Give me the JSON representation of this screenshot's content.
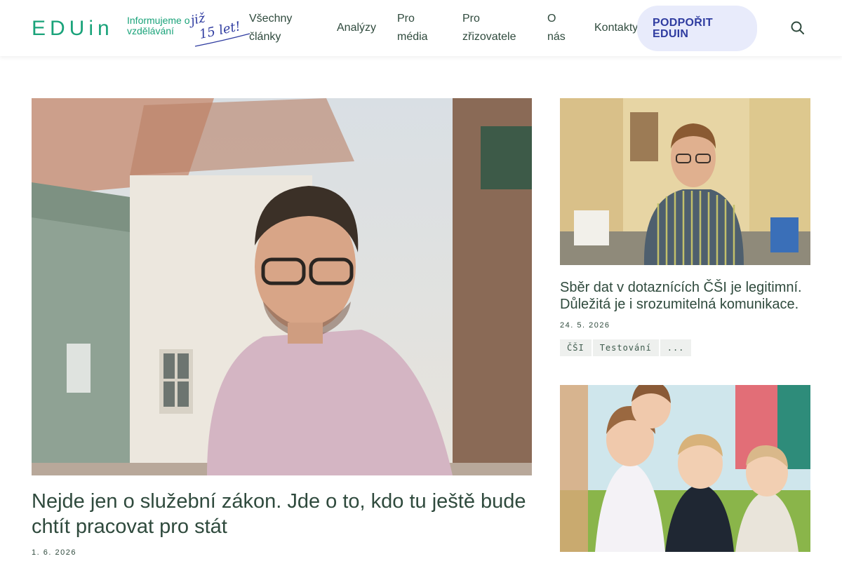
{
  "header": {
    "logo_text": "EDUin",
    "tagline": "Informujeme o vzdělávání",
    "anniversary": "již 15 let!",
    "nav": [
      {
        "label": "Všechny články"
      },
      {
        "label": "Analýzy"
      },
      {
        "label": "Pro média"
      },
      {
        "label": "Pro zřizovatele"
      },
      {
        "label": "O nás"
      },
      {
        "label": "Kontakty"
      }
    ],
    "support_label": "PODPOŘIT EDUIN",
    "search_icon": "search-icon"
  },
  "featured": {
    "title": "Nejde jen o služební zákon. Jde o to, kdo tu ještě bude chtít pracovat pro stát",
    "date": "1. 6. 2026"
  },
  "side_articles": [
    {
      "title": "Sběr dat v dotaznících ČŠI je legitimní. Důležitá je i srozumitelná komunikace.",
      "date": "24. 5. 2026",
      "tags": [
        "ČŠI",
        "Testování",
        "..."
      ]
    }
  ],
  "colors": {
    "brand_green": "#1aa37a",
    "text_dark": "#2f4a3d",
    "support_bg": "#e8ebfb",
    "support_text": "#2f3ca0"
  }
}
